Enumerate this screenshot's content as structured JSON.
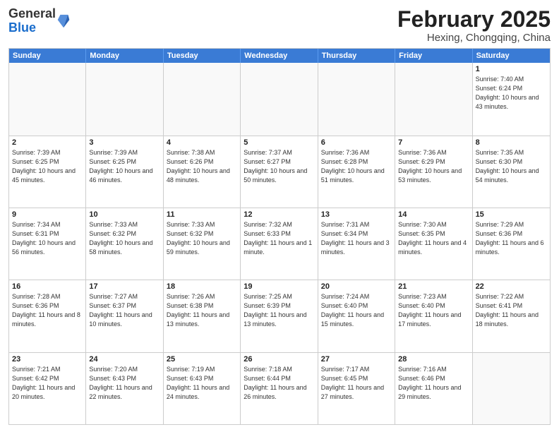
{
  "logo": {
    "general": "General",
    "blue": "Blue"
  },
  "title": "February 2025",
  "location": "Hexing, Chongqing, China",
  "calendar": {
    "headers": [
      "Sunday",
      "Monday",
      "Tuesday",
      "Wednesday",
      "Thursday",
      "Friday",
      "Saturday"
    ],
    "rows": [
      [
        {
          "day": "",
          "info": ""
        },
        {
          "day": "",
          "info": ""
        },
        {
          "day": "",
          "info": ""
        },
        {
          "day": "",
          "info": ""
        },
        {
          "day": "",
          "info": ""
        },
        {
          "day": "",
          "info": ""
        },
        {
          "day": "1",
          "info": "Sunrise: 7:40 AM\nSunset: 6:24 PM\nDaylight: 10 hours\nand 43 minutes."
        }
      ],
      [
        {
          "day": "2",
          "info": "Sunrise: 7:39 AM\nSunset: 6:25 PM\nDaylight: 10 hours\nand 45 minutes."
        },
        {
          "day": "3",
          "info": "Sunrise: 7:39 AM\nSunset: 6:25 PM\nDaylight: 10 hours\nand 46 minutes."
        },
        {
          "day": "4",
          "info": "Sunrise: 7:38 AM\nSunset: 6:26 PM\nDaylight: 10 hours\nand 48 minutes."
        },
        {
          "day": "5",
          "info": "Sunrise: 7:37 AM\nSunset: 6:27 PM\nDaylight: 10 hours\nand 50 minutes."
        },
        {
          "day": "6",
          "info": "Sunrise: 7:36 AM\nSunset: 6:28 PM\nDaylight: 10 hours\nand 51 minutes."
        },
        {
          "day": "7",
          "info": "Sunrise: 7:36 AM\nSunset: 6:29 PM\nDaylight: 10 hours\nand 53 minutes."
        },
        {
          "day": "8",
          "info": "Sunrise: 7:35 AM\nSunset: 6:30 PM\nDaylight: 10 hours\nand 54 minutes."
        }
      ],
      [
        {
          "day": "9",
          "info": "Sunrise: 7:34 AM\nSunset: 6:31 PM\nDaylight: 10 hours\nand 56 minutes."
        },
        {
          "day": "10",
          "info": "Sunrise: 7:33 AM\nSunset: 6:32 PM\nDaylight: 10 hours\nand 58 minutes."
        },
        {
          "day": "11",
          "info": "Sunrise: 7:33 AM\nSunset: 6:32 PM\nDaylight: 10 hours\nand 59 minutes."
        },
        {
          "day": "12",
          "info": "Sunrise: 7:32 AM\nSunset: 6:33 PM\nDaylight: 11 hours\nand 1 minute."
        },
        {
          "day": "13",
          "info": "Sunrise: 7:31 AM\nSunset: 6:34 PM\nDaylight: 11 hours\nand 3 minutes."
        },
        {
          "day": "14",
          "info": "Sunrise: 7:30 AM\nSunset: 6:35 PM\nDaylight: 11 hours\nand 4 minutes."
        },
        {
          "day": "15",
          "info": "Sunrise: 7:29 AM\nSunset: 6:36 PM\nDaylight: 11 hours\nand 6 minutes."
        }
      ],
      [
        {
          "day": "16",
          "info": "Sunrise: 7:28 AM\nSunset: 6:36 PM\nDaylight: 11 hours\nand 8 minutes."
        },
        {
          "day": "17",
          "info": "Sunrise: 7:27 AM\nSunset: 6:37 PM\nDaylight: 11 hours\nand 10 minutes."
        },
        {
          "day": "18",
          "info": "Sunrise: 7:26 AM\nSunset: 6:38 PM\nDaylight: 11 hours\nand 13 minutes."
        },
        {
          "day": "19",
          "info": "Sunrise: 7:25 AM\nSunset: 6:39 PM\nDaylight: 11 hours\nand 13 minutes."
        },
        {
          "day": "20",
          "info": "Sunrise: 7:24 AM\nSunset: 6:40 PM\nDaylight: 11 hours\nand 15 minutes."
        },
        {
          "day": "21",
          "info": "Sunrise: 7:23 AM\nSunset: 6:40 PM\nDaylight: 11 hours\nand 17 minutes."
        },
        {
          "day": "22",
          "info": "Sunrise: 7:22 AM\nSunset: 6:41 PM\nDaylight: 11 hours\nand 18 minutes."
        }
      ],
      [
        {
          "day": "23",
          "info": "Sunrise: 7:21 AM\nSunset: 6:42 PM\nDaylight: 11 hours\nand 20 minutes."
        },
        {
          "day": "24",
          "info": "Sunrise: 7:20 AM\nSunset: 6:43 PM\nDaylight: 11 hours\nand 22 minutes."
        },
        {
          "day": "25",
          "info": "Sunrise: 7:19 AM\nSunset: 6:43 PM\nDaylight: 11 hours\nand 24 minutes."
        },
        {
          "day": "26",
          "info": "Sunrise: 7:18 AM\nSunset: 6:44 PM\nDaylight: 11 hours\nand 26 minutes."
        },
        {
          "day": "27",
          "info": "Sunrise: 7:17 AM\nSunset: 6:45 PM\nDaylight: 11 hours\nand 27 minutes."
        },
        {
          "day": "28",
          "info": "Sunrise: 7:16 AM\nSunset: 6:46 PM\nDaylight: 11 hours\nand 29 minutes."
        },
        {
          "day": "",
          "info": ""
        }
      ]
    ]
  }
}
